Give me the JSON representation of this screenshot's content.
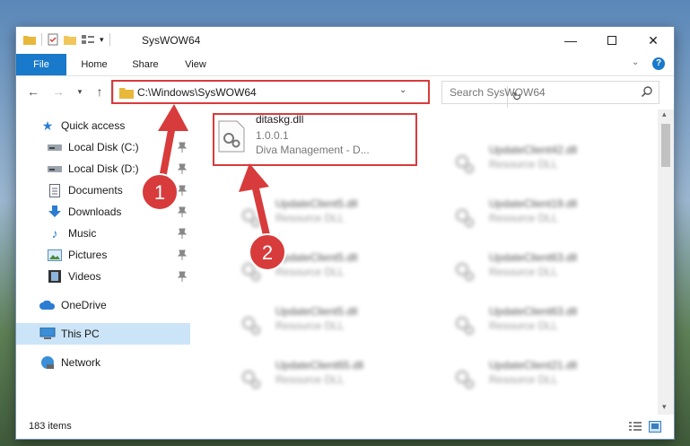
{
  "window": {
    "title": "SysWOW64"
  },
  "ribbon": {
    "tabs": [
      "File",
      "Home",
      "Share",
      "View"
    ]
  },
  "address": {
    "path": "C:\\Windows\\SysWOW64"
  },
  "search": {
    "placeholder": "Search SysWOW64"
  },
  "nav": {
    "quick_access": "Quick access",
    "items": [
      "Local Disk (C:)",
      "Local Disk (D:)",
      "Documents",
      "Downloads",
      "Music",
      "Pictures",
      "Videos"
    ],
    "onedrive": "OneDrive",
    "this_pc": "This PC",
    "network": "Network"
  },
  "files": {
    "highlighted": {
      "name": "ditaskg.dll",
      "version": "1.0.0.1",
      "desc": "Diva Management - D..."
    },
    "left_column": [
      {
        "name": "UpdateClient5.dll",
        "type": "Resource DLL"
      },
      {
        "name": "UpdateClient5.dll",
        "type": "Resource DLL"
      },
      {
        "name": "UpdateClient5.dll",
        "type": "Resource DLL"
      },
      {
        "name": "UpdateClient65.dll",
        "type": "Resource DLL"
      }
    ],
    "right_column": [
      {
        "name": "UpdateClient42.dll",
        "type": "Resource DLL"
      },
      {
        "name": "UpdateClient19.dll",
        "type": "Resource DLL"
      },
      {
        "name": "UpdateClient63.dll",
        "type": "Resource DLL"
      },
      {
        "name": "UpdateClient63.dll",
        "type": "Resource DLL"
      },
      {
        "name": "UpdateClient21.dll",
        "type": "Resource DLL"
      }
    ]
  },
  "status": {
    "count": "183 items"
  },
  "annotations": {
    "step1": "1",
    "step2": "2"
  },
  "colors": {
    "accent": "#1979ca",
    "highlight": "#d83b3b",
    "selected": "#cce4f7"
  }
}
